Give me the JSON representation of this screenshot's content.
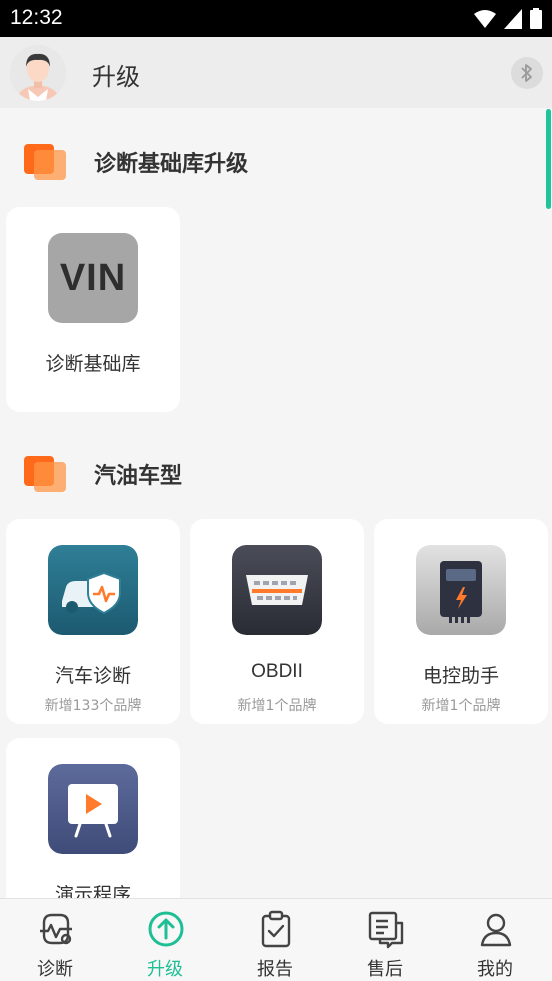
{
  "status_bar": {
    "time": "12:32"
  },
  "header": {
    "title": "升级"
  },
  "sections": [
    {
      "title": "诊断基础库升级"
    },
    {
      "title": "汽油车型"
    }
  ],
  "cards": [
    {
      "name": "诊断基础库",
      "sub": "",
      "icon": "vin-icon"
    },
    {
      "name": "汽车诊断",
      "sub": "新增133个品牌",
      "icon": "car-diagnosis-icon"
    },
    {
      "name": "OBDII",
      "sub": "新增1个品牌",
      "icon": "obd-connector-icon"
    },
    {
      "name": "电控助手",
      "sub": "新增1个品牌",
      "icon": "ecu-helper-icon"
    },
    {
      "name": "演示程序",
      "sub": "",
      "icon": "demo-play-icon"
    }
  ],
  "vin_text": "VIN",
  "tabs": [
    {
      "label": "诊断",
      "icon": "diagnosis-icon",
      "active": false
    },
    {
      "label": "升级",
      "icon": "upgrade-icon",
      "active": true
    },
    {
      "label": "报告",
      "icon": "report-icon",
      "active": false
    },
    {
      "label": "售后",
      "icon": "after-sales-icon",
      "active": false
    },
    {
      "label": "我的",
      "icon": "profile-icon",
      "active": false
    }
  ],
  "colors": {
    "accent": "#1fbf95",
    "section_mark": "#ff6a1a"
  }
}
